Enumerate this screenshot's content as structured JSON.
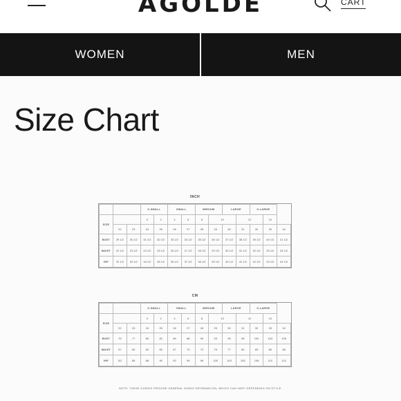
{
  "header": {
    "brand": "AGOLDE",
    "cart_label": "CART",
    "icons": {
      "menu": "hamburger-menu-icon",
      "search": "search-icon"
    }
  },
  "nav": {
    "tabs": [
      "WOMEN",
      "MEN"
    ]
  },
  "page_title": "Size Chart",
  "tables": [
    {
      "caption": "INCH",
      "groups": [
        "X-SMALL",
        "SMALL",
        "MEDIUM",
        "LARGE",
        "X-LARGE"
      ],
      "size_row_label": "SIZE",
      "alpha_sizes": [
        "0",
        "2",
        "4",
        "6",
        "8",
        "10",
        "12",
        "14"
      ],
      "numeric_sizes": [
        "22",
        "23",
        "24",
        "25",
        "26",
        "27",
        "28",
        "29",
        "30",
        "31",
        "32",
        "33",
        "34"
      ],
      "rows": [
        {
          "label": "BUST",
          "values": [
            "29 1/2",
            "30 1/2",
            "31 1/2",
            "32 1/2",
            "33 1/2",
            "34 1/2",
            "35 1/2",
            "36 1/2",
            "37 1/2",
            "38 1/2",
            "39 1/2",
            "40 1/2",
            "41 1/2"
          ]
        },
        {
          "label": "WAIST",
          "values": [
            "22 1/2",
            "23 1/2",
            "24 1/2",
            "25 1/2",
            "26 1/2",
            "27 1/2",
            "28 1/2",
            "29 1/2",
            "30 1/2",
            "31 1/2",
            "32 1/2",
            "33 1/2",
            "34 1/2"
          ]
        },
        {
          "label": "HIP",
          "values": [
            "32 1/2",
            "33 1/2",
            "34 1/2",
            "35 1/2",
            "36 1/2",
            "37 1/2",
            "38 1/2",
            "39 1/2",
            "40 1/2",
            "41 1/2",
            "42 1/2",
            "43 1/2",
            "44 1/2"
          ]
        }
      ]
    },
    {
      "caption": "CM",
      "groups": [
        "X-SMALL",
        "SMALL",
        "MEDIUM",
        "LARGE",
        "X-LARGE"
      ],
      "size_row_label": "SIZE",
      "alpha_sizes": [
        "0",
        "2",
        "4",
        "6",
        "8",
        "10",
        "12",
        "14"
      ],
      "numeric_sizes": [
        "22",
        "23",
        "24",
        "25",
        "26",
        "27",
        "28",
        "29",
        "30",
        "31",
        "32",
        "33",
        "34"
      ],
      "rows": [
        {
          "label": "BUST",
          "values": [
            "75",
            "77",
            "80",
            "82",
            "85",
            "88",
            "90",
            "93",
            "95",
            "98",
            "100",
            "103",
            "105"
          ]
        },
        {
          "label": "WAIST",
          "values": [
            "57",
            "60",
            "62",
            "65",
            "67",
            "70",
            "72",
            "75",
            "77",
            "80",
            "83",
            "85",
            "88"
          ]
        },
        {
          "label": "HIP",
          "values": [
            "83",
            "85",
            "88",
            "90",
            "92",
            "95",
            "96",
            "100",
            "103",
            "105",
            "108",
            "110",
            "113"
          ]
        }
      ]
    }
  ],
  "footnote": "NOTE: THESE GUIDES PROVIDE GENERAL SIZING INFORMATION, WHICH CAN VARY DEPENDING ON STYLE."
}
